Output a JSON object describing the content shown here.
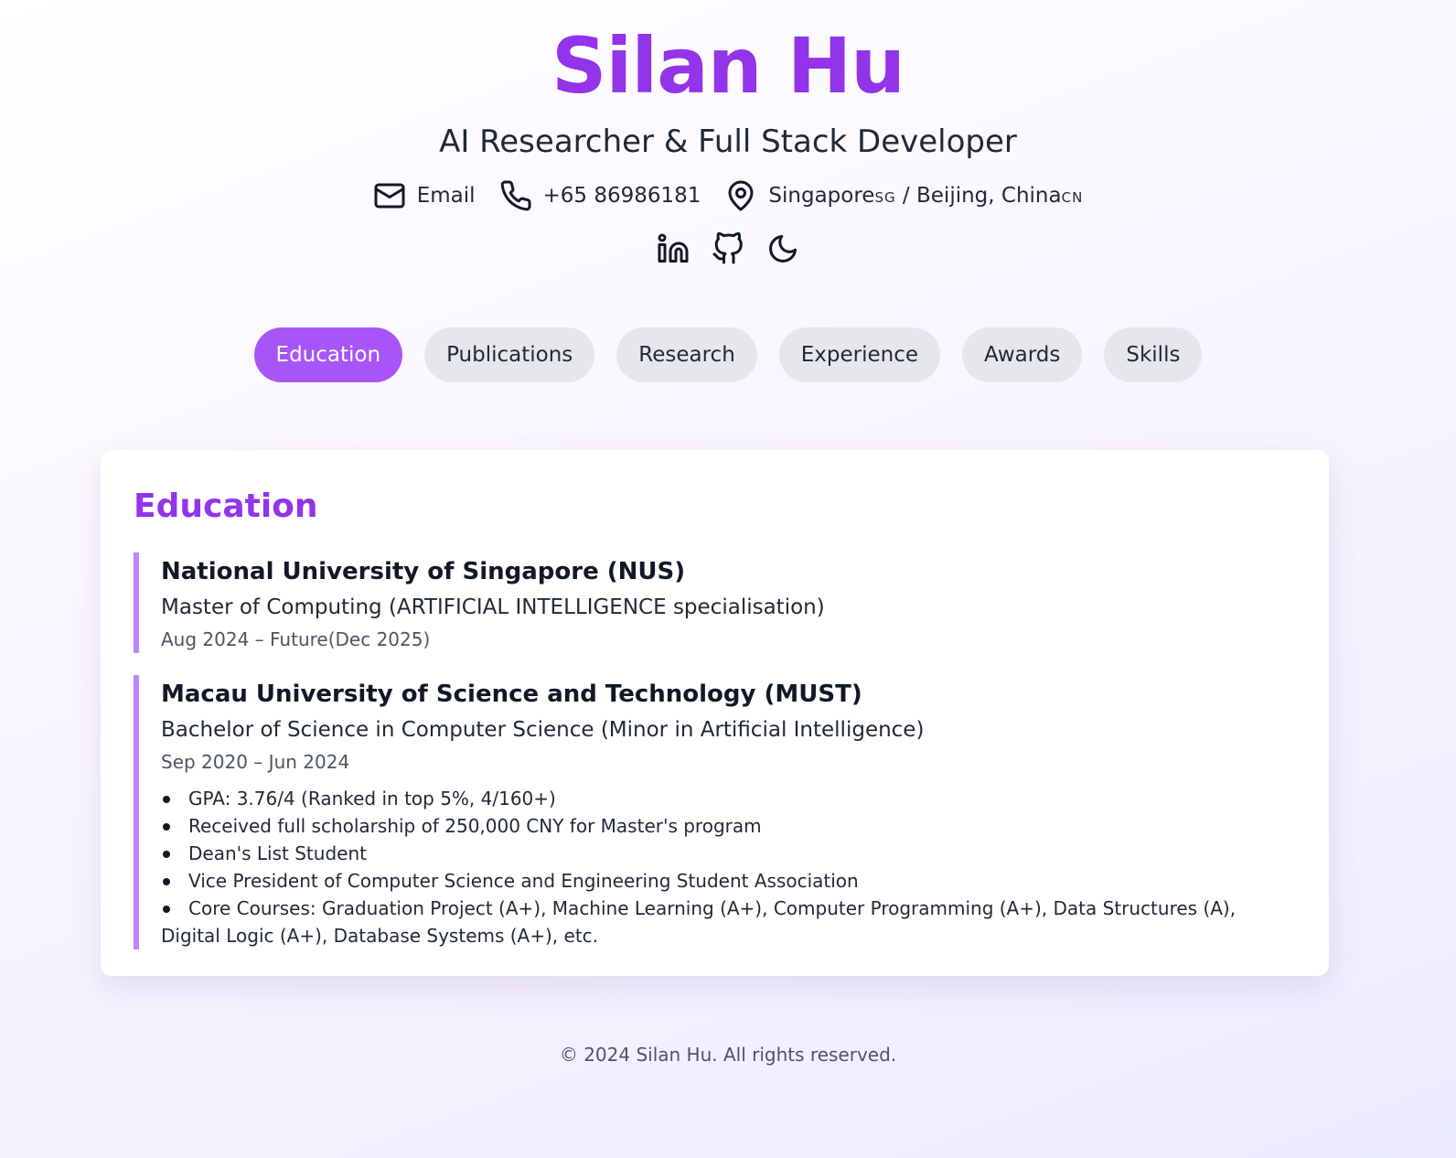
{
  "header": {
    "name": "Silan Hu",
    "title": "AI Researcher & Full Stack Developer",
    "email_label": "Email",
    "phone": "+65 86986181",
    "location_1": "Singapore",
    "location_1_code": "SG",
    "location_separator": " / ",
    "location_2": "Beijing, China",
    "location_2_code": "CN",
    "icons": [
      "mail-icon",
      "phone-icon",
      "map-pin-icon",
      "linkedin-icon",
      "github-icon",
      "moon-icon"
    ]
  },
  "tabs": [
    {
      "label": "Education",
      "active": true
    },
    {
      "label": "Publications",
      "active": false
    },
    {
      "label": "Research",
      "active": false
    },
    {
      "label": "Experience",
      "active": false
    },
    {
      "label": "Awards",
      "active": false
    },
    {
      "label": "Skills",
      "active": false
    }
  ],
  "section": {
    "title": "Education",
    "entries": [
      {
        "institution": "National University of Singapore (NUS)",
        "degree": "Master of Computing (ARTIFICIAL INTELLIGENCE specialisation)",
        "dates": "Aug 2024 – Future(Dec 2025)"
      },
      {
        "institution": "Macau University of Science and Technology (MUST)",
        "degree": "Bachelor of Science in Computer Science (Minor in Artificial Intelligence)",
        "dates": "Sep 2020 – Jun 2024",
        "bullets": [
          "GPA: 3.76/4 (Ranked in top 5%, 4/160+)",
          "Received full scholarship of 250,000 CNY for Master's program",
          "Dean's List Student",
          "Vice President of Computer Science and Engineering Student Association",
          "Core Courses: Graduation Project (A+), Machine Learning (A+), Computer Programming (A+), Data Structures (A), Digital Logic (A+), Database Systems (A+), etc."
        ]
      }
    ]
  },
  "footer": {
    "text": "© 2024 Silan Hu. All rights reserved."
  },
  "colors": {
    "accent": "#9333ea",
    "tab_active": "#a855f7",
    "tab_inactive": "#e5e7eb",
    "entry_border": "#c084fc"
  }
}
